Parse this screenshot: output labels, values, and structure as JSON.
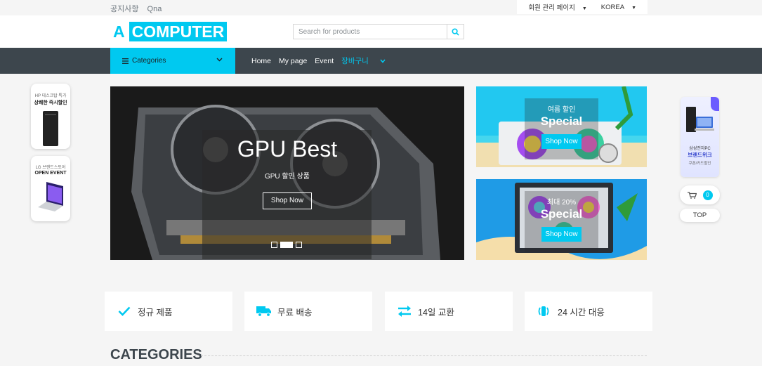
{
  "topbar": {
    "links": [
      "공지사항",
      "Qna"
    ],
    "admin_label": "회원 관리 페이지",
    "lang_label": "KOREA"
  },
  "header": {
    "logo_a": "A",
    "logo_b": "COMPUTER",
    "search_placeholder": "Search for products"
  },
  "nav": {
    "categories_label": "Categories",
    "items": [
      "Home",
      "My page",
      "Event",
      "장바구니"
    ]
  },
  "carousel": {
    "title": "GPU Best",
    "subtitle": "GPU 할인 상품",
    "button": "Shop Now",
    "slides": 3,
    "active_slide": 2
  },
  "offers": [
    {
      "tag": "여름 할인",
      "title": "Special",
      "button": "Shop Now"
    },
    {
      "tag": "최대 20%",
      "title": "Special",
      "button": "Shop Now"
    }
  ],
  "left_ads": [
    {
      "line1": "HP 데스크탑 특가",
      "line2": "상쾌한 즉시할인"
    },
    {
      "line1": "LG 브랜드스토어",
      "line2": "OPEN EVENT"
    }
  ],
  "right_ad": {
    "line1": "삼성전자PC",
    "line2": "브랜드위크",
    "line3": "쿠폰/카드할인"
  },
  "floating": {
    "cart_count": "0",
    "top_label": "TOP"
  },
  "features": [
    {
      "icon": "check-icon",
      "label": "정규 제품"
    },
    {
      "icon": "truck-icon",
      "label": "무료 배송"
    },
    {
      "icon": "exchange-icon",
      "label": "14일 교환"
    },
    {
      "icon": "phone-icon",
      "label": "24 시간 대응"
    }
  ],
  "section": {
    "heading": "CATEGORIES"
  },
  "colors": {
    "accent": "#00c9f0",
    "dark": "#3d464d"
  }
}
